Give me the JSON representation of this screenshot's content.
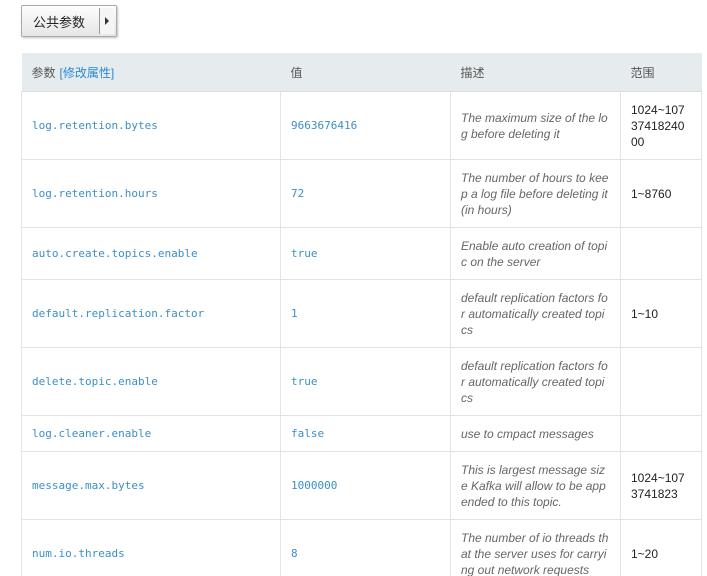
{
  "selector": {
    "label": "公共参数",
    "icon": "dropdown-arrow-icon"
  },
  "table": {
    "headers": {
      "param": "参数",
      "edit_link": "[修改属性]",
      "value": "值",
      "description": "描述",
      "range": "范围"
    },
    "rows": [
      {
        "name": "log.retention.bytes",
        "value": "9663676416",
        "description": "The maximum size of the log before deleting it",
        "range": "1024~10737418240 00"
      },
      {
        "name": "log.retention.hours",
        "value": "72",
        "description": "The number of hours to keep a log file before deleting it (in hours)",
        "range": "1~8760"
      },
      {
        "name": "auto.create.topics.enable",
        "value": "true",
        "description": "Enable auto creation of topic on the server",
        "range": ""
      },
      {
        "name": "default.replication.factor",
        "value": "1",
        "description": "default replication factors for automatically created topics",
        "range": "1~10"
      },
      {
        "name": "delete.topic.enable",
        "value": "true",
        "description": "default replication factors for automatically created topics",
        "range": ""
      },
      {
        "name": "log.cleaner.enable",
        "value": "false",
        "description": "use to cmpact messages",
        "range": ""
      },
      {
        "name": "message.max.bytes",
        "value": "1000000",
        "description": "This is largest message size Kafka will allow to be appended to this topic.",
        "range": "1024~1073741823"
      },
      {
        "name": "num.io.threads",
        "value": "8",
        "description": "The number of io threads that the server uses for carrying out network requests",
        "range": "1~20"
      }
    ]
  },
  "colors": {
    "header_bg": "#e6ebee",
    "link": "#2a8ad2",
    "mono_text": "#3b8fc8"
  }
}
